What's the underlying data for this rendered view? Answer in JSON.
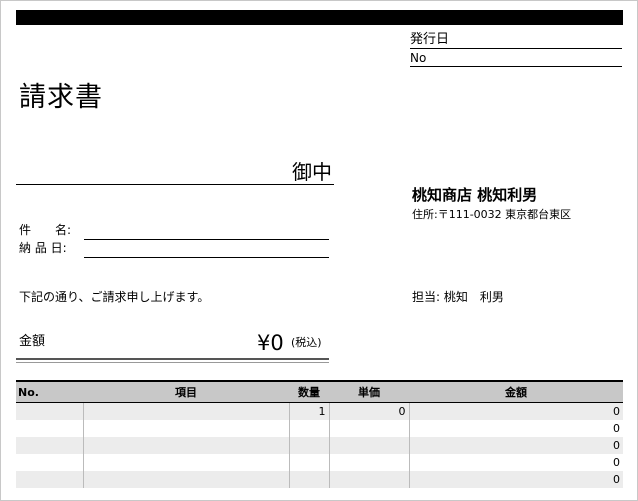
{
  "header": {
    "issued_label": "発行日",
    "number_label": "No"
  },
  "title": "請求書",
  "recipient": {
    "honorific": "御中"
  },
  "issuer": {
    "company": "桃知商店 桃知利男",
    "address": "住所:〒111-0032  東京都台東区",
    "contact": "担当: 桃知　利男"
  },
  "fields": {
    "subject_label": "件　　名:",
    "delivery_label": "納 品 日:"
  },
  "message": "下記の通り、ご請求申し上げます。",
  "amount": {
    "label": "金額",
    "value": "¥0",
    "tax_note": "(税込)"
  },
  "table": {
    "headers": [
      "No.",
      "項目",
      "数量",
      "単価",
      "金額"
    ],
    "rows": [
      [
        "",
        "",
        "1",
        "0",
        "0"
      ],
      [
        "",
        "",
        "",
        "",
        "0"
      ],
      [
        "",
        "",
        "",
        "",
        "0"
      ],
      [
        "",
        "",
        "",
        "",
        "0"
      ],
      [
        "",
        "",
        "",
        "",
        "0"
      ]
    ]
  }
}
